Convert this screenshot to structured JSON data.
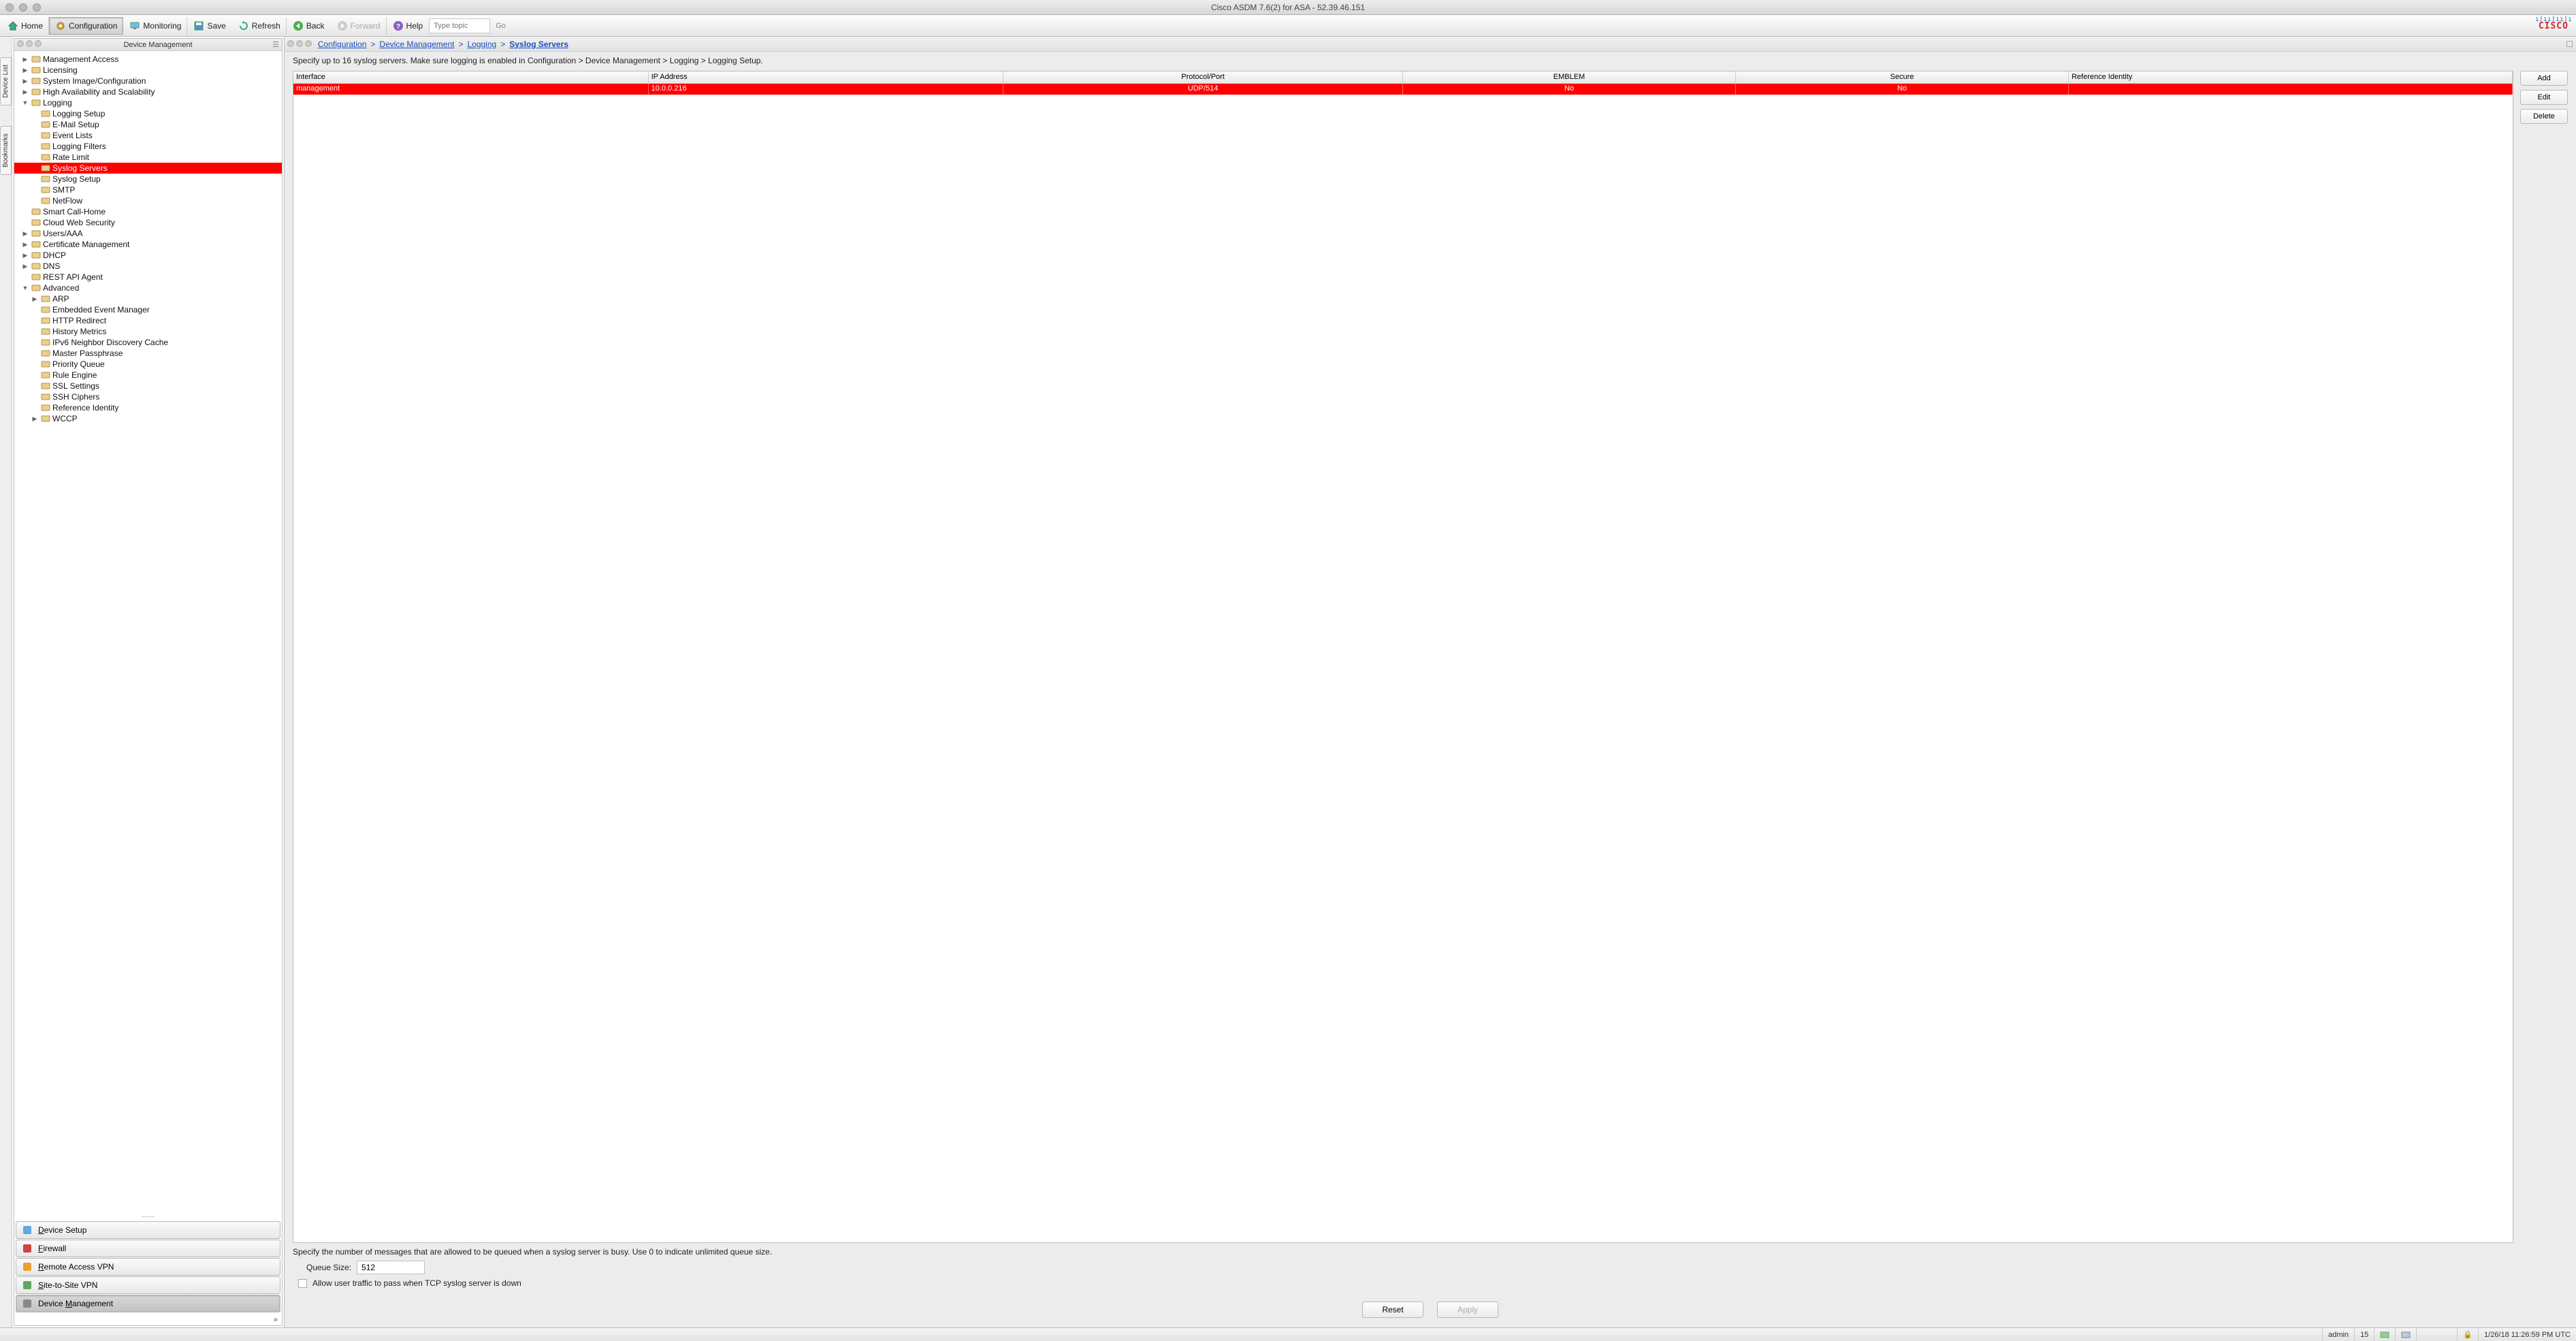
{
  "title": "Cisco ASDM 7.6(2) for ASA - 52.39.46.151",
  "logo_brand": "CISCO",
  "toolbar": {
    "home": "Home",
    "configuration": "Configuration",
    "monitoring": "Monitoring",
    "save": "Save",
    "refresh": "Refresh",
    "back": "Back",
    "forward": "Forward",
    "help": "Help",
    "search_placeholder": "Type topic",
    "go": "Go"
  },
  "sidetab1": "Device List",
  "sidetab2": "Bookmarks",
  "left": {
    "title": "Device Management",
    "tree": [
      {
        "lvl": 0,
        "d": "▶",
        "l": "Management Access"
      },
      {
        "lvl": 0,
        "d": "▶",
        "l": "Licensing"
      },
      {
        "lvl": 0,
        "d": "▶",
        "l": "System Image/Configuration"
      },
      {
        "lvl": 0,
        "d": "▶",
        "l": "High Availability and Scalability"
      },
      {
        "lvl": 0,
        "d": "▼",
        "l": "Logging"
      },
      {
        "lvl": 1,
        "d": "",
        "l": "Logging Setup"
      },
      {
        "lvl": 1,
        "d": "",
        "l": "E-Mail Setup"
      },
      {
        "lvl": 1,
        "d": "",
        "l": "Event Lists"
      },
      {
        "lvl": 1,
        "d": "",
        "l": "Logging Filters"
      },
      {
        "lvl": 1,
        "d": "",
        "l": "Rate Limit"
      },
      {
        "lvl": 1,
        "d": "",
        "l": "Syslog Servers",
        "sel": true
      },
      {
        "lvl": 1,
        "d": "",
        "l": "Syslog Setup"
      },
      {
        "lvl": 1,
        "d": "",
        "l": "SMTP"
      },
      {
        "lvl": 1,
        "d": "",
        "l": "NetFlow"
      },
      {
        "lvl": 0,
        "d": "",
        "l": "Smart Call-Home"
      },
      {
        "lvl": 0,
        "d": "",
        "l": "Cloud Web Security"
      },
      {
        "lvl": 0,
        "d": "▶",
        "l": "Users/AAA"
      },
      {
        "lvl": 0,
        "d": "▶",
        "l": "Certificate Management"
      },
      {
        "lvl": 0,
        "d": "▶",
        "l": "DHCP"
      },
      {
        "lvl": 0,
        "d": "▶",
        "l": "DNS"
      },
      {
        "lvl": 0,
        "d": "",
        "l": "REST API Agent"
      },
      {
        "lvl": 0,
        "d": "▼",
        "l": "Advanced"
      },
      {
        "lvl": 1,
        "d": "▶",
        "l": "ARP"
      },
      {
        "lvl": 1,
        "d": "",
        "l": "Embedded Event Manager"
      },
      {
        "lvl": 1,
        "d": "",
        "l": "HTTP Redirect"
      },
      {
        "lvl": 1,
        "d": "",
        "l": "History Metrics"
      },
      {
        "lvl": 1,
        "d": "",
        "l": "IPv6 Neighbor Discovery Cache"
      },
      {
        "lvl": 1,
        "d": "",
        "l": "Master Passphrase"
      },
      {
        "lvl": 1,
        "d": "",
        "l": "Priority Queue"
      },
      {
        "lvl": 1,
        "d": "",
        "l": "Rule Engine"
      },
      {
        "lvl": 1,
        "d": "",
        "l": "SSL Settings"
      },
      {
        "lvl": 1,
        "d": "",
        "l": "SSH Ciphers"
      },
      {
        "lvl": 1,
        "d": "",
        "l": "Reference Identity"
      },
      {
        "lvl": 1,
        "d": "▶",
        "l": "WCCP"
      }
    ],
    "nav": [
      {
        "l": "Device Setup",
        "u": "D"
      },
      {
        "l": "Firewall",
        "u": "F"
      },
      {
        "l": "Remote Access VPN",
        "u": "R"
      },
      {
        "l": "Site-to-Site VPN",
        "u": "S"
      },
      {
        "l": "Device Management",
        "u": "M",
        "active": true
      }
    ],
    "expand": "»"
  },
  "breadcrumb": {
    "p1": "Configuration",
    "p2": "Device Management",
    "p3": "Logging",
    "p4": "Syslog Servers",
    "sep": ">"
  },
  "main": {
    "desc": "Specify up to 16 syslog servers. Make sure logging is enabled in Configuration > Device Management > Logging > Logging Setup.",
    "cols": [
      "Interface",
      "IP Address",
      "Protocol/Port",
      "EMBLEM",
      "Secure",
      "Reference Identity"
    ],
    "rows": [
      {
        "c1": "management",
        "c2": "10.0.0.216",
        "c3": "UDP/514",
        "c4": "No",
        "c5": "No",
        "c6": ""
      }
    ],
    "btn_add": "Add",
    "btn_edit": "Edit",
    "btn_delete": "Delete",
    "queue_desc": "Specify the number of messages that are allowed to be queued when a syslog server is busy. Use 0 to indicate unlimited queue size.",
    "queue_label": "Queue Size:",
    "queue_value": "512",
    "allow_label": "Allow user traffic to pass when TCP syslog server is down",
    "reset": "Reset",
    "apply": "Apply"
  },
  "status": {
    "user": "admin",
    "num": "15",
    "time": "1/26/18 11:26:59 PM UTC"
  }
}
